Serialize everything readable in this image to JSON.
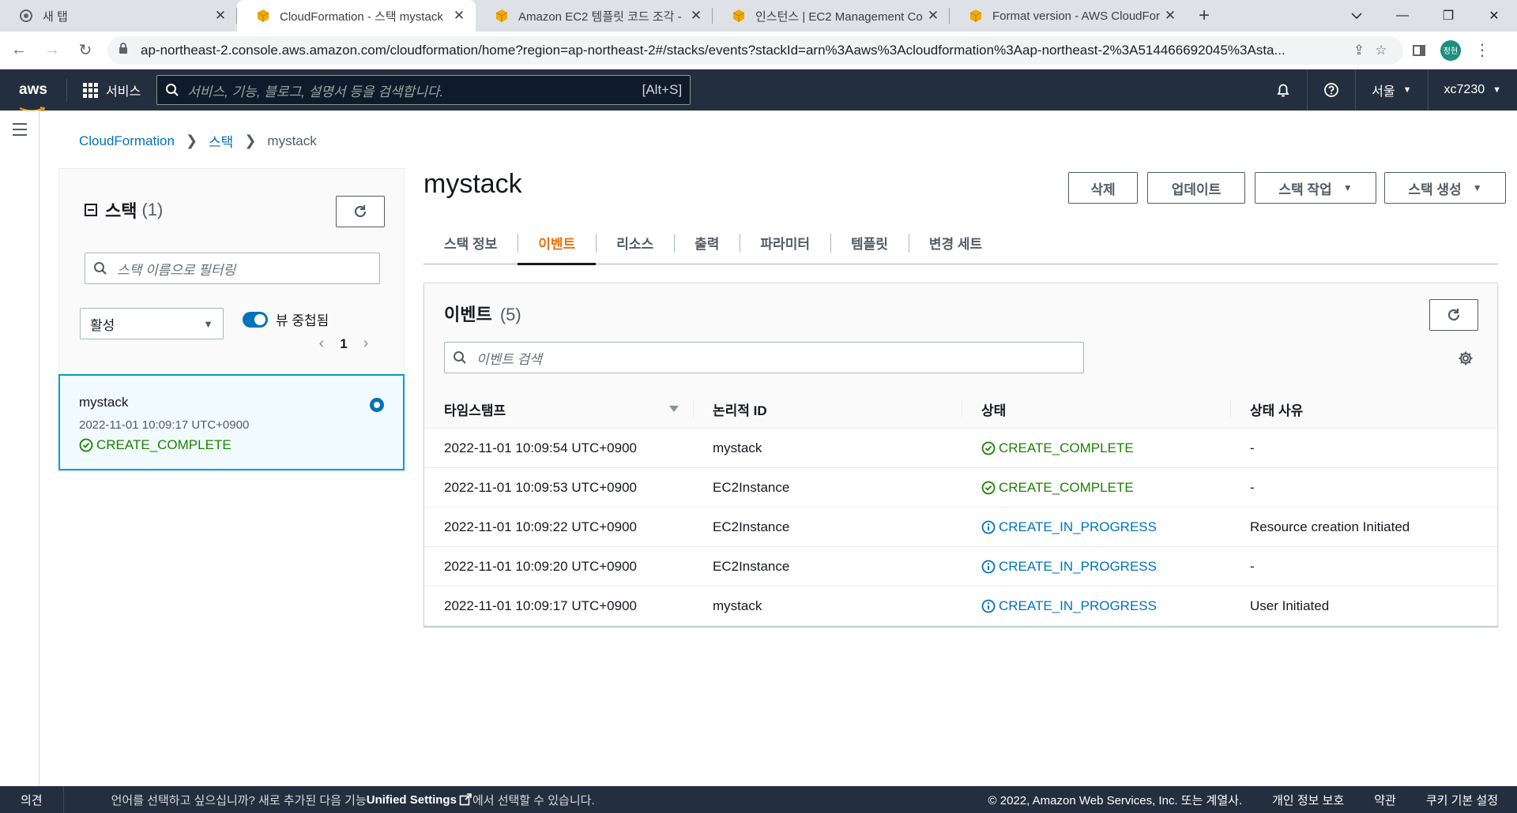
{
  "browser": {
    "tabs": [
      {
        "title": "새 탭",
        "active": false
      },
      {
        "title": "CloudFormation - 스택 mystack",
        "active": true
      },
      {
        "title": "Amazon EC2 템플릿 코드 조각 -",
        "active": false
      },
      {
        "title": "인스턴스 | EC2 Management Co",
        "active": false
      },
      {
        "title": "Format version - AWS CloudFor",
        "active": false
      }
    ],
    "url": "ap-northeast-2.console.aws.amazon.com/cloudformation/home?region=ap-northeast-2#/stacks/events?stackId=arn%3Aaws%3Acloudformation%3Aap-northeast-2%3A514466692045%3Asta...",
    "profile_initials": "정현"
  },
  "aws_nav": {
    "logo": "aws",
    "services_label": "서비스",
    "search_placeholder": "서비스, 기능, 블로그, 설명서 등을 검색합니다.",
    "search_shortcut": "[Alt+S]",
    "region": "서울",
    "account": "xc7230"
  },
  "breadcrumb": {
    "items": [
      "CloudFormation",
      "스택",
      "mystack"
    ]
  },
  "stack_panel": {
    "title": "스택",
    "count": "(1)",
    "filter_placeholder": "스택 이름으로 필터링",
    "status_filter": "활성",
    "nested_toggle_label": "뷰 중첩됨",
    "page": "1",
    "stacks": [
      {
        "name": "mystack",
        "created": "2022-11-01 10:09:17 UTC+0900",
        "status": "CREATE_COMPLETE"
      }
    ]
  },
  "main": {
    "title": "mystack",
    "buttons": {
      "delete": "삭제",
      "update": "업데이트",
      "stack_actions": "스택 작업",
      "create_stack": "스택 생성"
    },
    "tabs": [
      "스택 정보",
      "이벤트",
      "리소스",
      "출력",
      "파라미터",
      "템플릿",
      "변경 세트"
    ],
    "active_tab": "이벤트"
  },
  "events": {
    "title": "이벤트",
    "count": "(5)",
    "search_placeholder": "이벤트 검색",
    "columns": [
      "타임스탬프",
      "논리적 ID",
      "상태",
      "상태 사유"
    ],
    "rows": [
      {
        "timestamp": "2022-11-01 10:09:54 UTC+0900",
        "logical_id": "mystack",
        "status": "CREATE_COMPLETE",
        "status_kind": "ok",
        "reason": "-"
      },
      {
        "timestamp": "2022-11-01 10:09:53 UTC+0900",
        "logical_id": "EC2Instance",
        "status": "CREATE_COMPLETE",
        "status_kind": "ok",
        "reason": "-"
      },
      {
        "timestamp": "2022-11-01 10:09:22 UTC+0900",
        "logical_id": "EC2Instance",
        "status": "CREATE_IN_PROGRESS",
        "status_kind": "prog",
        "reason": "Resource creation Initiated"
      },
      {
        "timestamp": "2022-11-01 10:09:20 UTC+0900",
        "logical_id": "EC2Instance",
        "status": "CREATE_IN_PROGRESS",
        "status_kind": "prog",
        "reason": "-"
      },
      {
        "timestamp": "2022-11-01 10:09:17 UTC+0900",
        "logical_id": "mystack",
        "status": "CREATE_IN_PROGRESS",
        "status_kind": "prog",
        "reason": "User Initiated"
      }
    ]
  },
  "footer": {
    "feedback": "의견",
    "lang_text_1": "언어를 선택하고 싶으십니까? 새로 추가된 다음 기능",
    "lang_link": "Unified Settings",
    "lang_text_2": "에서 선택할 수 있습니다.",
    "copyright": "© 2022, Amazon Web Services, Inc. 또는 계열사.",
    "privacy": "개인 정보 보호",
    "terms": "약관",
    "cookies": "쿠키 기본 설정"
  },
  "colors": {
    "aws_nav_bg": "#232f3e",
    "link": "#0073bb",
    "success": "#1d8102",
    "active_tab": "#ec7211",
    "selected_border": "#00a1c9"
  },
  "icons": [
    "chrome-icon",
    "cube-icon",
    "close-icon",
    "plus-icon",
    "back-icon",
    "forward-icon",
    "reload-icon",
    "lock-icon",
    "share-icon",
    "star-icon",
    "sidepanel-icon",
    "more-icon",
    "grid-icon",
    "search-icon",
    "bell-icon",
    "help-icon",
    "caret-icon",
    "menu-icon",
    "refresh-icon",
    "success-icon",
    "info-icon",
    "gear-icon",
    "external-link-icon"
  ]
}
